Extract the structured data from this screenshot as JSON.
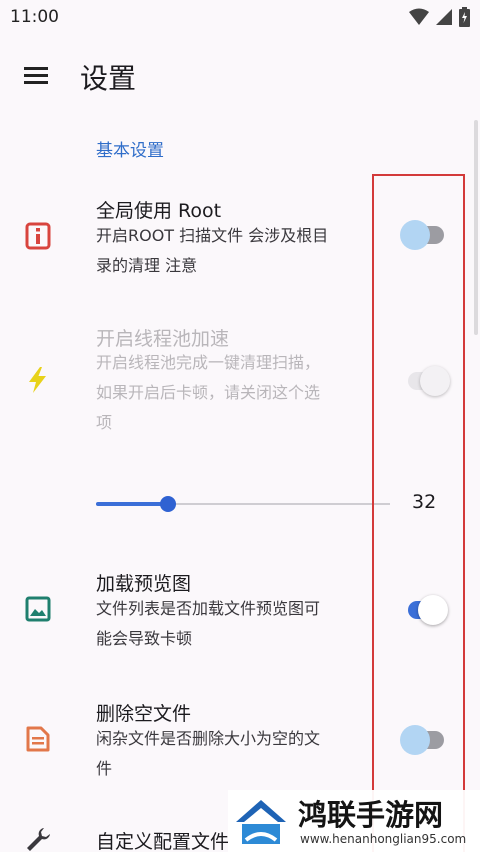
{
  "status_bar": {
    "time": "11:00",
    "icons": [
      "wifi-icon",
      "signal-icon",
      "battery-icon"
    ]
  },
  "app_bar": {
    "menu_icon": "hamburger-menu-icon",
    "title": "设置"
  },
  "section": {
    "label": "基本设置",
    "color": "#2f6dc9"
  },
  "settings": [
    {
      "title": "全局使用 Root",
      "desc": [
        "开启ROOT 扫描文件 会涉及根目",
        "录的清理 注意"
      ],
      "icon": "info-box-icon",
      "state": "off",
      "enabled": true
    },
    {
      "title": "开启线程池加速",
      "desc": [
        "开启线程池完成一键清理扫描，",
        "如果开启后卡顿，请关闭这个选",
        "项"
      ],
      "icon": "lightning-bolt-icon",
      "state": "off",
      "enabled": false
    },
    {
      "title": "加载预览图",
      "desc": [
        "文件列表是否加载文件预览图可",
        "能会导致卡顿"
      ],
      "icon": "image-icon",
      "state": "on",
      "enabled": true
    },
    {
      "title": "删除空文件",
      "desc": [
        "闲杂文件是否删除大小为空的文",
        "件"
      ],
      "icon": "document-icon",
      "state": "off",
      "enabled": true
    },
    {
      "title": "自定义配置文件",
      "icon": "wrench-icon"
    }
  ],
  "slider": {
    "value": "32",
    "fraction": 0.245
  },
  "colors": {
    "accent": "#3b6fd8",
    "highlight_box": "#d33a3a",
    "info_icon": "#d8443e",
    "bolt_icon": "#e8d21a",
    "image_icon": "#1f7f6e",
    "doc_icon": "#e2774a"
  },
  "watermark": {
    "brand": "鸿联手游网",
    "url": "www.henanhonglian95.com"
  }
}
